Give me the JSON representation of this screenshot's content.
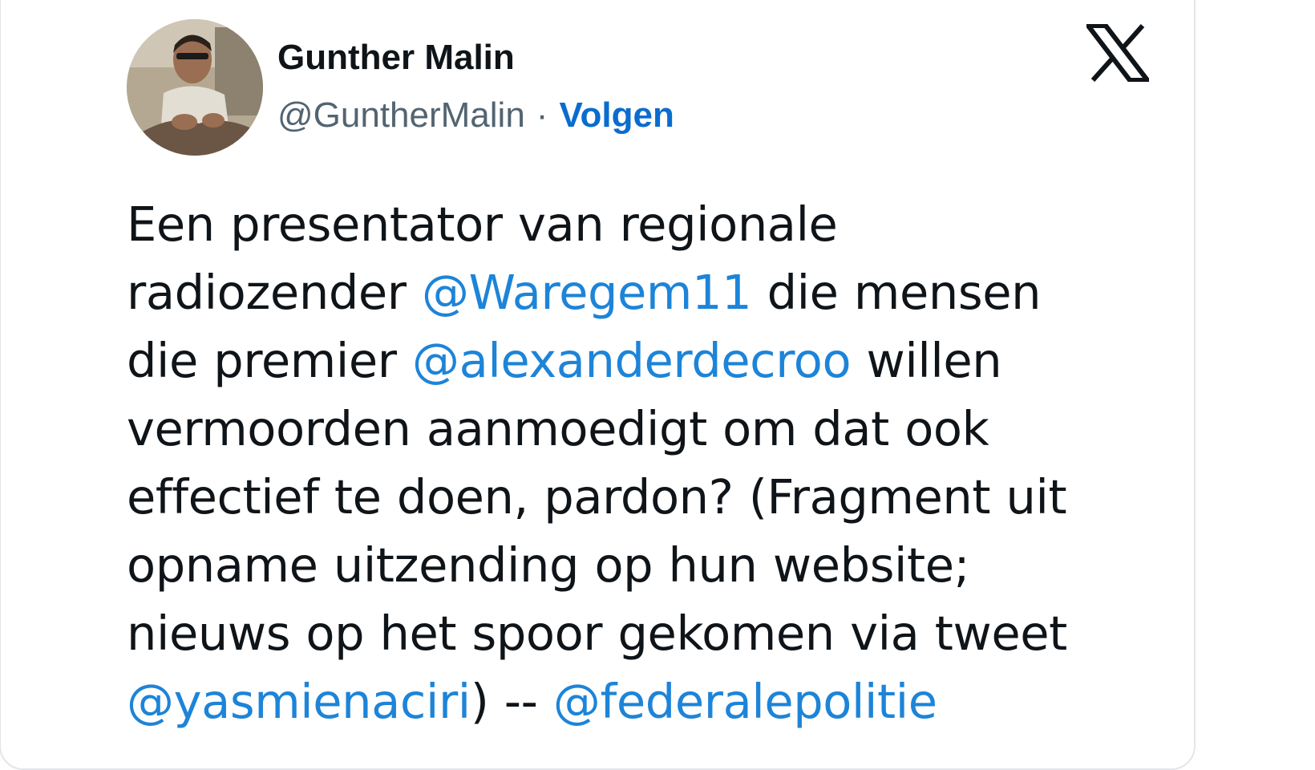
{
  "author": {
    "display_name": "Gunther Malin",
    "handle": "@GuntherMalin",
    "separator": "·",
    "follow_label": "Volgen"
  },
  "platform_icon": "x-logo-icon",
  "tweet": {
    "line1": "Een presentator van regionale",
    "line2_a": "radiozender ",
    "mention_1": "@Waregem11",
    "line2_b": " die mensen",
    "line3_a": "die premier ",
    "mention_2": "@alexanderdecroo",
    "line3_b": " willen",
    "line4": "vermoorden aanmoedigt om dat ook",
    "line5": "effectief te doen, pardon? (Fragment uit",
    "line6": "opname uitzending op hun website;",
    "line7": "nieuws op het spoor gekomen via tweet",
    "mention_3": "@yasmienaciri",
    "line8_b": ") -- ",
    "mention_4": "@federalepolitie"
  },
  "colors": {
    "link": "#1d84d8",
    "follow": "#0a6ccf",
    "text": "#0f1419",
    "secondary": "#536471"
  }
}
